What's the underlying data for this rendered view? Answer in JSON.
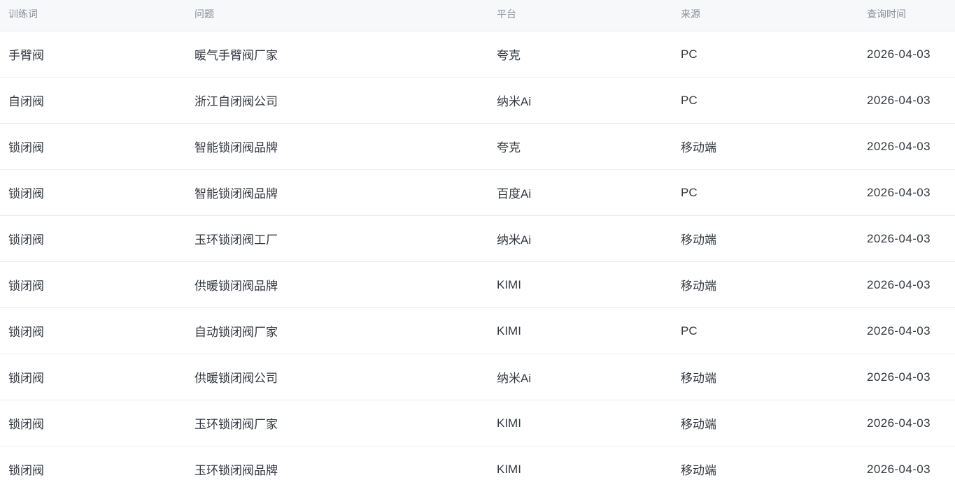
{
  "table": {
    "columns": [
      "训练词",
      "问题",
      "平台",
      "来源",
      "查询时间"
    ],
    "rows": [
      [
        "手臂阀",
        "暖气手臂阀厂家",
        "夸克",
        "PC",
        "2026-04-03"
      ],
      [
        "自闭阀",
        "浙江自闭阀公司",
        "纳米Ai",
        "PC",
        "2026-04-03"
      ],
      [
        "锁闭阀",
        "智能锁闭阀品牌",
        "夸克",
        "移动端",
        "2026-04-03"
      ],
      [
        "锁闭阀",
        "智能锁闭阀品牌",
        "百度Ai",
        "PC",
        "2026-04-03"
      ],
      [
        "锁闭阀",
        "玉环锁闭阀工厂",
        "纳米Ai",
        "移动端",
        "2026-04-03"
      ],
      [
        "锁闭阀",
        "供暖锁闭阀品牌",
        "KIMI",
        "移动端",
        "2026-04-03"
      ],
      [
        "锁闭阀",
        "自动锁闭阀厂家",
        "KIMI",
        "PC",
        "2026-04-03"
      ],
      [
        "锁闭阀",
        "供暖锁闭阀公司",
        "纳米Ai",
        "移动端",
        "2026-04-03"
      ],
      [
        "锁闭阀",
        "玉环锁闭阀厂家",
        "KIMI",
        "移动端",
        "2026-04-03"
      ],
      [
        "锁闭阀",
        "玉环锁闭阀品牌",
        "KIMI",
        "移动端",
        "2026-04-03"
      ]
    ]
  }
}
